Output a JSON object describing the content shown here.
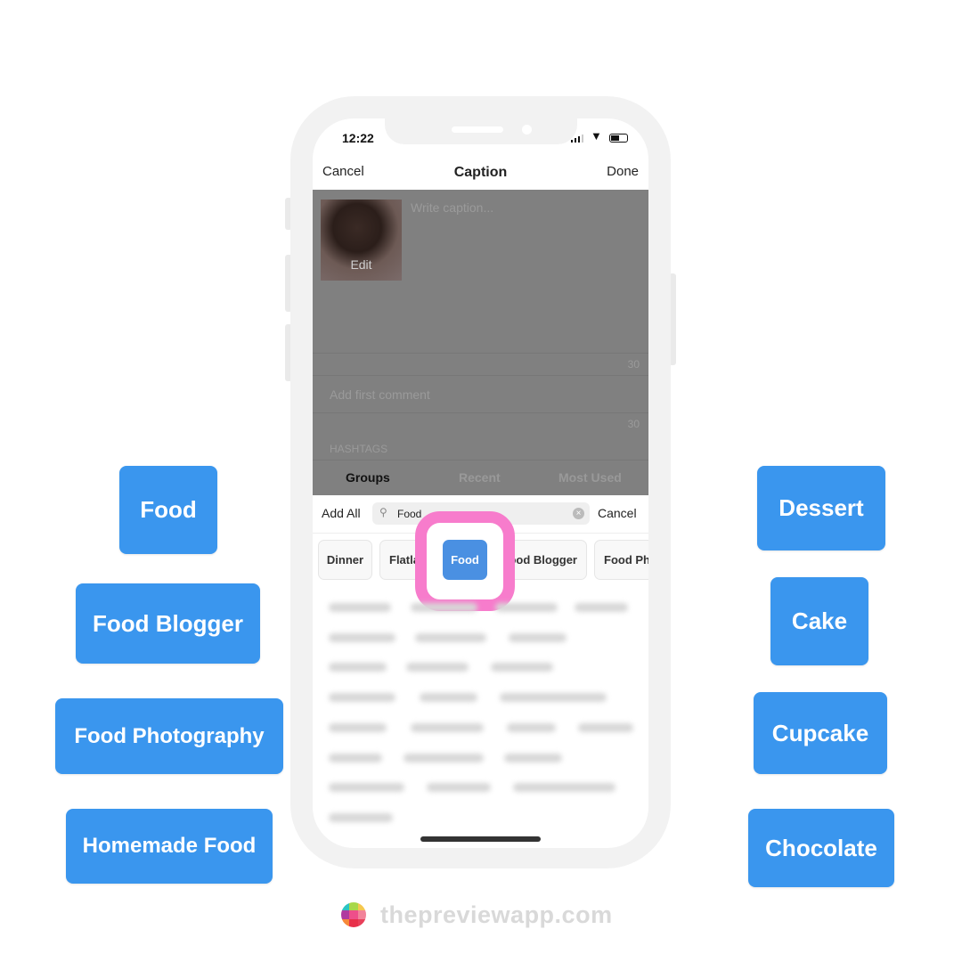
{
  "left_tags": [
    "Food",
    "Food Blogger",
    "Food Photography",
    "Homemade Food"
  ],
  "right_tags": [
    "Dessert",
    "Cake",
    "Cupcake",
    "Chocolate"
  ],
  "status": {
    "time": "12:22"
  },
  "nav": {
    "cancel": "Cancel",
    "title": "Caption",
    "done": "Done"
  },
  "post": {
    "edit": "Edit",
    "caption_placeholder": "Write caption...",
    "caption_count": "30",
    "comment_placeholder": "Add first comment",
    "comment_count": "30",
    "hashtags_label": "HASHTAGS"
  },
  "tabs": [
    "Groups",
    "Recent",
    "Most Used"
  ],
  "search": {
    "add_all": "Add All",
    "value": "Food",
    "cancel": "Cancel"
  },
  "chips": [
    "Dinner",
    "Flatlay",
    "Food",
    "Food Blogger",
    "Food Ph"
  ],
  "colors": {
    "tag_blue": "#3a96ee",
    "chip_selected": "#4a90e2",
    "highlight_ring": "#f77ccc"
  },
  "footer": {
    "brand": "thepreviewapp.com"
  }
}
